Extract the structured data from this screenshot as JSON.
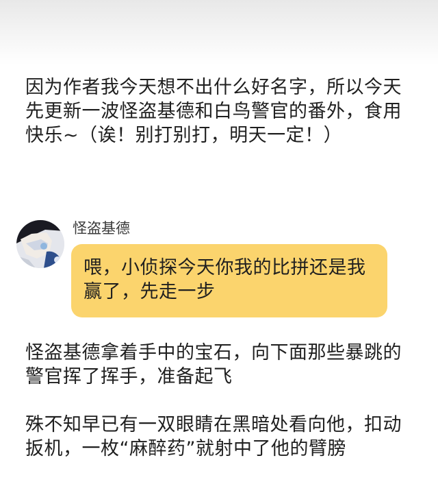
{
  "post": {
    "intro": "因为作者我今天想不出什么好名字，所以今天先更新一波怪盗基德和白鸟警官的番外，食用快乐~（诶！别打别打，明天一定！）",
    "dialogue": {
      "speaker": "怪盗基德",
      "avatar": "kaito-kid-avatar",
      "message": "喂，小侦探今天你我的比拼还是我赢了，先走一步",
      "bubble_color": "#fbd46d"
    },
    "paragraphs": [
      "怪盗基德拿着手中的宝石，向下面那些暴跳的警官挥了挥手，准备起飞",
      "殊不知早已有一双眼睛在黑暗处看向他，扣动扳机，一枚“麻醉药”就射中了他的臂膀"
    ]
  }
}
